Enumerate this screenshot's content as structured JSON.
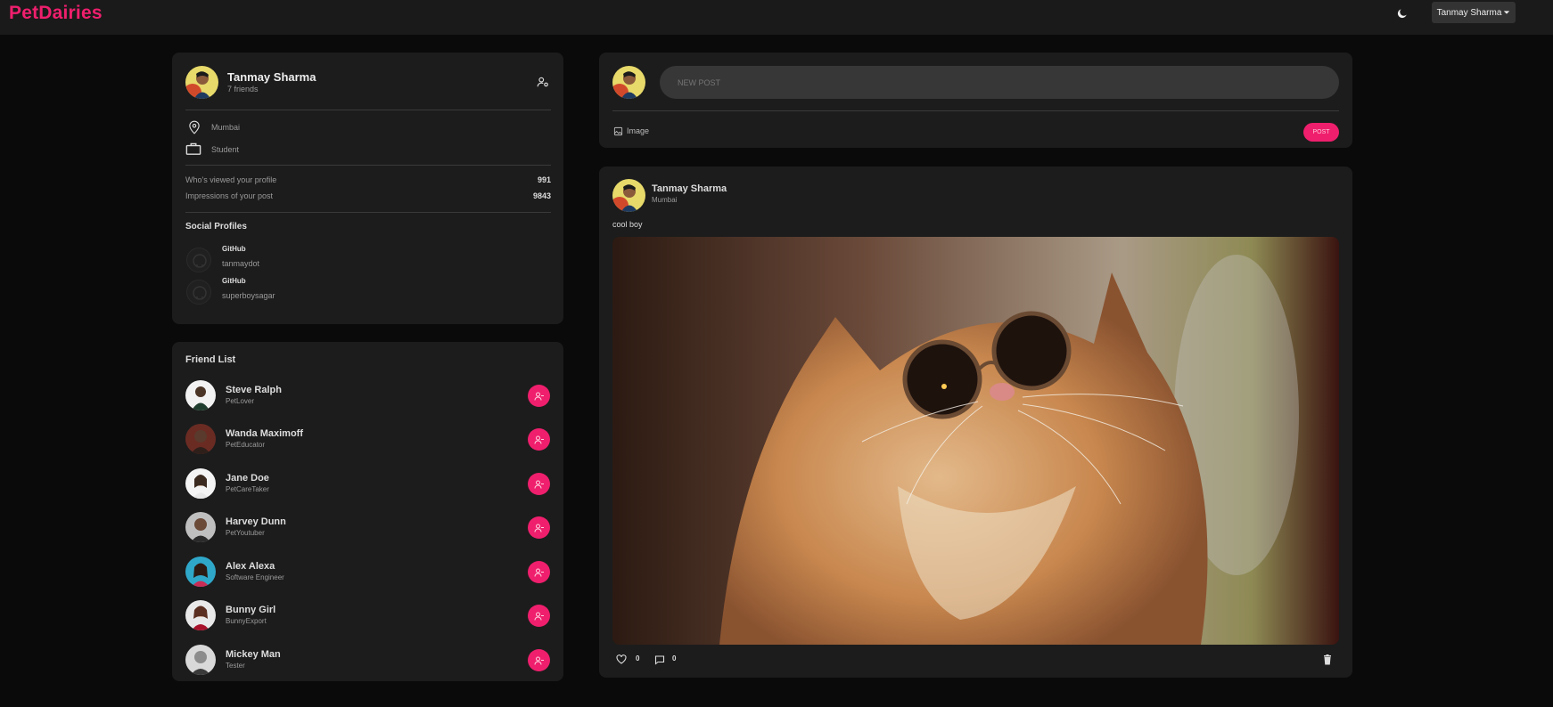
{
  "app": {
    "title": "PetDairies"
  },
  "navbar": {
    "user_menu": "Tanmay Sharma",
    "theme_icon": "moon-icon"
  },
  "profile": {
    "name": "Tanmay Sharma",
    "friends": "7 friends",
    "location": "Mumbai",
    "occupation": "Student",
    "stats": [
      {
        "label": "Who's viewed your profile",
        "value": "991"
      },
      {
        "label": "Impressions of your post",
        "value": "9843"
      }
    ],
    "social_heading": "Social Profiles",
    "social": [
      {
        "platform": "GitHub",
        "handle": "tanmaydot"
      },
      {
        "platform": "GitHub",
        "handle": "superboysagar"
      }
    ]
  },
  "friend_list": {
    "heading": "Friend List",
    "friends": [
      {
        "name": "Steve Ralph",
        "role": "PetLover"
      },
      {
        "name": "Wanda Maximoff",
        "role": "PetEducator"
      },
      {
        "name": "Jane Doe",
        "role": "PetCareTaker"
      },
      {
        "name": "Harvey Dunn",
        "role": "PetYoutuber"
      },
      {
        "name": "Alex Alexa",
        "role": "Software Engineer"
      },
      {
        "name": "Bunny Girl",
        "role": "BunnyExport"
      },
      {
        "name": "Mickey Man",
        "role": "Tester"
      }
    ]
  },
  "composer": {
    "placeholder": "NEW POST",
    "image_label": "Image",
    "post_button": "POST"
  },
  "post": {
    "author": "Tanmay Sharma",
    "location": "Mumbai",
    "caption": "cool boy",
    "likes": "0",
    "comments": "0"
  },
  "colors": {
    "accent": "#ef1f6d",
    "background": "#0a0a0a",
    "card": "#1c1c1c",
    "navbar": "#1a1a1a"
  }
}
